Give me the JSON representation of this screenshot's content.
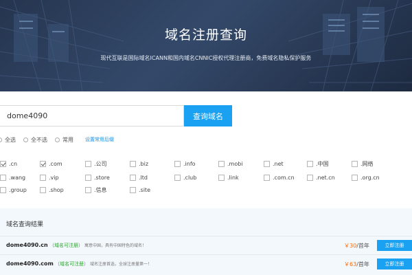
{
  "hero": {
    "title": "域名注册查询",
    "subtitle": "现代互联是国际域名ICANN和国内域名CNNIC授权代理注册商，免费域名隐私保护服务"
  },
  "search": {
    "value": "dome4090",
    "button_label": "查询域名"
  },
  "selection": {
    "all_label": "全选",
    "none_label": "全不选",
    "common_label": "常用",
    "set_common_link": "设置常用后缀"
  },
  "tlds": [
    {
      "name": ".cn",
      "checked": true
    },
    {
      "name": ".com",
      "checked": true
    },
    {
      "name": ".公司",
      "checked": false
    },
    {
      "name": ".biz",
      "checked": false
    },
    {
      "name": ".info",
      "checked": false
    },
    {
      "name": ".mobi",
      "checked": false
    },
    {
      "name": ".net",
      "checked": false
    },
    {
      "name": ".中国",
      "checked": false
    },
    {
      "name": ".网络",
      "checked": false
    },
    {
      "name": ".wang",
      "checked": false
    },
    {
      "name": ".vip",
      "checked": false
    },
    {
      "name": ".store",
      "checked": false
    },
    {
      "name": ".ltd",
      "checked": false
    },
    {
      "name": ".club",
      "checked": false
    },
    {
      "name": ".link",
      "checked": false
    },
    {
      "name": ".com.cn",
      "checked": false
    },
    {
      "name": ".net.cn",
      "checked": false
    },
    {
      "name": ".org.cn",
      "checked": false
    },
    {
      "name": ".group",
      "checked": false
    },
    {
      "name": ".shop",
      "checked": false
    },
    {
      "name": ".信息",
      "checked": false
    },
    {
      "name": ".site",
      "checked": false
    }
  ],
  "results": {
    "title": "域名查询结果",
    "rows": [
      {
        "domain": "dome4090.cn",
        "status": "（域名可注册）",
        "description": "寓意中国，具有中国特色的域名！",
        "price": "￥30",
        "unit": "/首年",
        "button_label": "立即注册"
      },
      {
        "domain": "dome4090.com",
        "status": "（域名可注册）",
        "description": "域名注册首选，全球注册量第一！",
        "price": "￥63",
        "unit": "/首年",
        "button_label": "立即注册"
      }
    ]
  },
  "colors": {
    "accent": "#1aa1f2",
    "available": "#2ba42b",
    "price": "#ff6a00",
    "hero_bg": "#2a3b57"
  }
}
